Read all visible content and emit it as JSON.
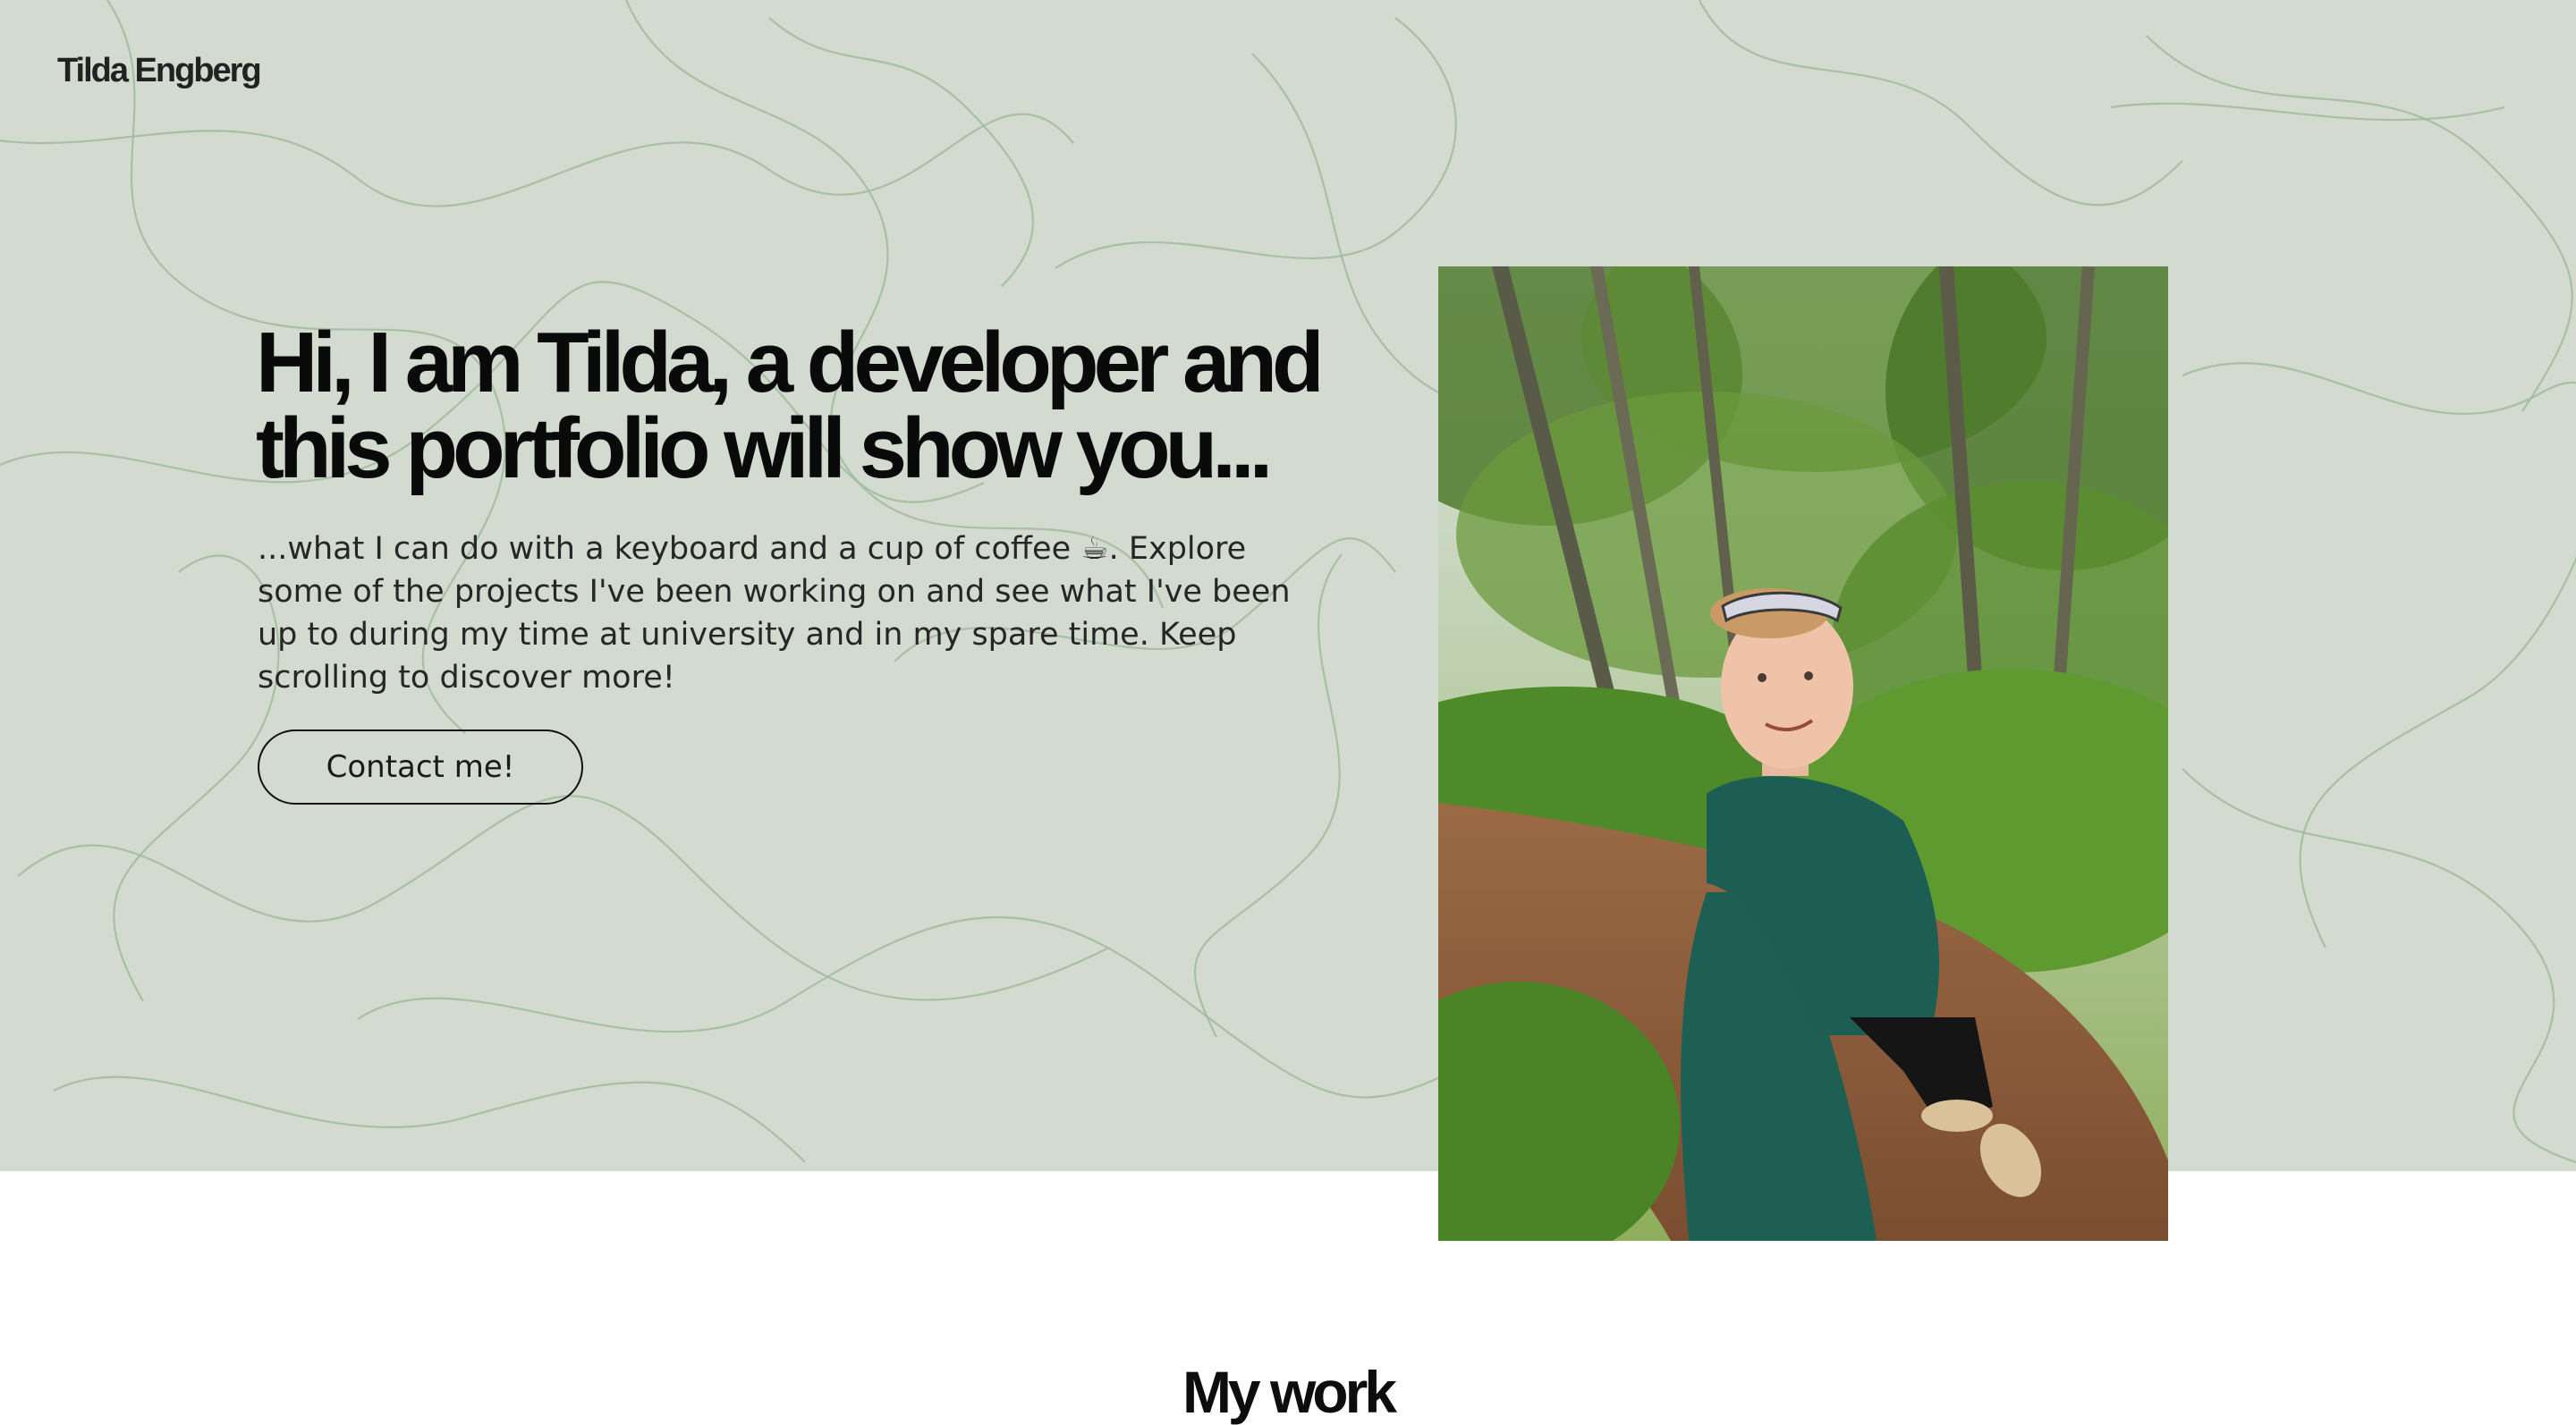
{
  "header": {
    "logo_text": "Tilda Engberg"
  },
  "hero": {
    "heading": "Hi, I am Tilda, a developer and this portfolio will show you...",
    "text": "...what I can do with a keyboard and a cup of coffee ☕. Explore some of the projects I've been working on and see what I've been up to during my time at university and in my spare time. Keep scrolling to discover more!",
    "contact_button_label": "Contact me!",
    "background_color": "#d3dacf",
    "squiggle_color": "#9fbb9c"
  },
  "photo": {
    "icon": "portrait-photo"
  },
  "work_section": {
    "heading": "My work"
  }
}
